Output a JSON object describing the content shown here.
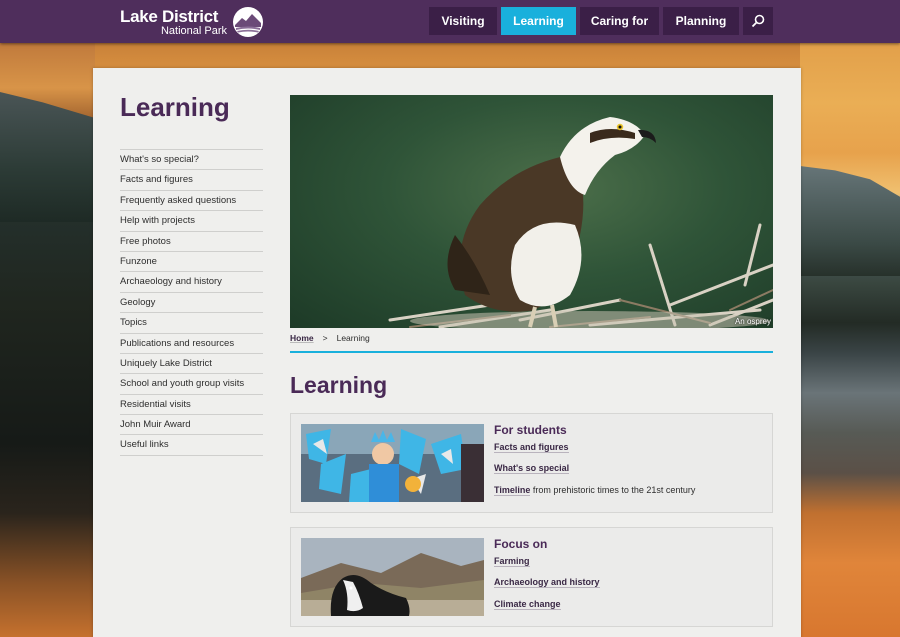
{
  "header": {
    "logo_title": "Lake District",
    "logo_subtitle": "National Park",
    "nav": [
      {
        "label": "Visiting",
        "active": false
      },
      {
        "label": "Learning",
        "active": true
      },
      {
        "label": "Caring for",
        "active": false
      },
      {
        "label": "Planning",
        "active": false
      }
    ],
    "search_icon": "search-icon",
    "colors": {
      "bar": "#4f2e5c",
      "button": "#3b1f47",
      "active": "#19b0dc"
    }
  },
  "sidebar": {
    "title": "Learning",
    "items": [
      "What's so special?",
      "Facts and figures",
      "Frequently asked questions",
      "Help with projects",
      "Free photos",
      "Funzone",
      "Archaeology and history",
      "Geology",
      "Topics",
      "Publications and resources",
      "Uniquely Lake District",
      "School and youth group visits",
      "Residential visits",
      "John Muir Award",
      "Useful links"
    ]
  },
  "hero": {
    "caption": "An osprey"
  },
  "breadcrumb": {
    "home": "Home",
    "separator": ">",
    "current": "Learning"
  },
  "main": {
    "title": "Learning",
    "cards": [
      {
        "heading": "For students",
        "links": [
          {
            "link": "Facts and figures",
            "rest": ""
          },
          {
            "link": "What's so special",
            "rest": ""
          },
          {
            "link": "Timeline",
            "rest": " from prehistoric times to the 21st century"
          }
        ]
      },
      {
        "heading": "Focus on",
        "links": [
          {
            "link": "Farming",
            "rest": ""
          },
          {
            "link": "Archaeology and history",
            "rest": ""
          },
          {
            "link": "Climate change",
            "rest": ""
          }
        ]
      }
    ]
  }
}
